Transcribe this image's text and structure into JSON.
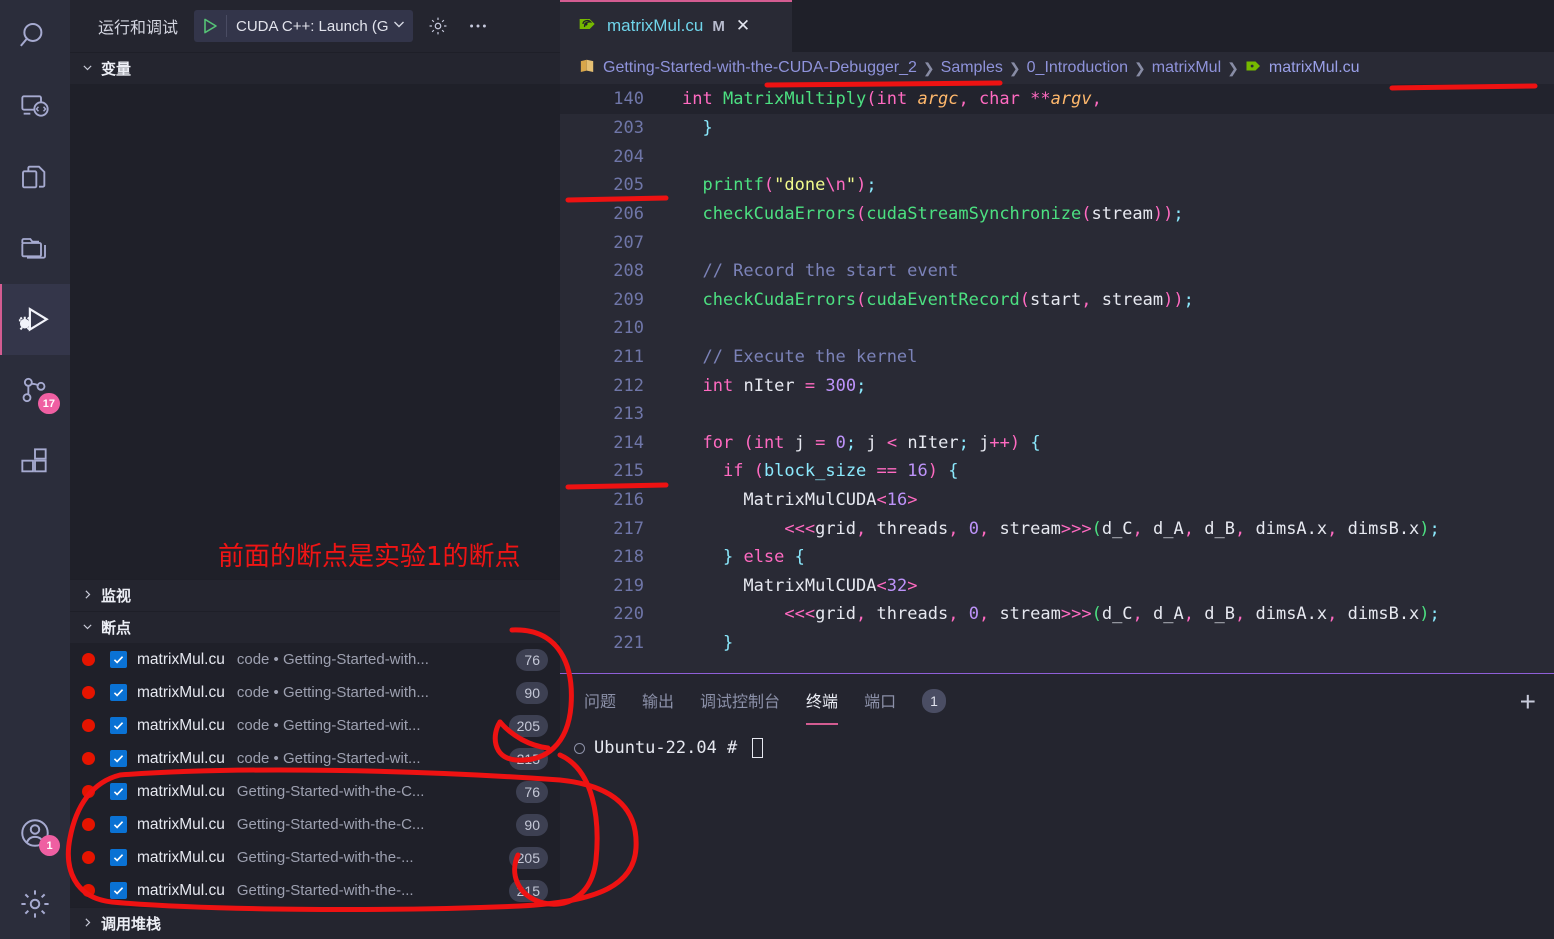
{
  "activity_bar": {
    "items": [
      {
        "name": "search-icon",
        "label": "搜索"
      },
      {
        "name": "remote-explorer-icon",
        "label": "远程资源管理器"
      },
      {
        "name": "copy-files-icon",
        "label": "文件"
      },
      {
        "name": "explorer-folder-icon",
        "label": "资源管理器"
      },
      {
        "name": "run-and-debug-icon",
        "label": "运行和调试"
      },
      {
        "name": "source-control-icon",
        "label": "源代码管理",
        "badge": "17"
      },
      {
        "name": "extensions-icon",
        "label": "扩展"
      }
    ],
    "bottom_items": [
      {
        "name": "accounts-icon",
        "label": "账户",
        "badge": "1"
      },
      {
        "name": "manage-gear-icon",
        "label": "管理"
      }
    ]
  },
  "sidebar": {
    "title": "运行和调试",
    "launch_config": "CUDA C++: Launch (G",
    "gear_tooltip": "打开\"launch.json\"",
    "more_tooltip": "更多操作",
    "sections": [
      {
        "label": "变量",
        "expanded": true
      },
      {
        "label": "监视",
        "expanded": false
      },
      {
        "label": "断点",
        "expanded": true
      },
      {
        "label": "调用堆栈",
        "expanded": false
      }
    ],
    "annotation": "前面的断点是实验1的断点",
    "breakpoints": [
      {
        "file": "matrixMul.cu",
        "path": "code • Getting-Started-with...",
        "line": "76",
        "enabled": true
      },
      {
        "file": "matrixMul.cu",
        "path": "code • Getting-Started-with...",
        "line": "90",
        "enabled": true
      },
      {
        "file": "matrixMul.cu",
        "path": "code • Getting-Started-wit...",
        "line": "205",
        "enabled": true
      },
      {
        "file": "matrixMul.cu",
        "path": "code • Getting-Started-wit...",
        "line": "215",
        "enabled": true
      },
      {
        "file": "matrixMul.cu",
        "path": "Getting-Started-with-the-C...",
        "line": "76",
        "enabled": true
      },
      {
        "file": "matrixMul.cu",
        "path": "Getting-Started-with-the-C...",
        "line": "90",
        "enabled": true
      },
      {
        "file": "matrixMul.cu",
        "path": "Getting-Started-with-the-...",
        "line": "205",
        "enabled": true
      },
      {
        "file": "matrixMul.cu",
        "path": "Getting-Started-with-the-...",
        "line": "215",
        "enabled": true
      }
    ]
  },
  "editor": {
    "tab": {
      "icon": "nvidia-cuda-icon",
      "label": "matrixMul.cu",
      "modified_badge": "M",
      "close": "✕"
    },
    "breadcrumb": [
      "Getting-Started-with-the-CUDA-Debugger_2",
      "Samples",
      "0_Introduction",
      "matrixMul",
      "matrixMul.cu"
    ],
    "sticky_line": {
      "num": "140",
      "text": "int MatrixMultiply(int argc, char **argv,"
    },
    "lines": [
      {
        "num": "203",
        "bp": false
      },
      {
        "num": "204",
        "bp": false
      },
      {
        "num": "205",
        "bp": true
      },
      {
        "num": "206",
        "bp": false
      },
      {
        "num": "207",
        "bp": false
      },
      {
        "num": "208",
        "bp": false
      },
      {
        "num": "209",
        "bp": false
      },
      {
        "num": "210",
        "bp": false
      },
      {
        "num": "211",
        "bp": false
      },
      {
        "num": "212",
        "bp": false
      },
      {
        "num": "213",
        "bp": false
      },
      {
        "num": "214",
        "bp": false
      },
      {
        "num": "215",
        "bp": true
      },
      {
        "num": "216",
        "bp": false
      },
      {
        "num": "217",
        "bp": false
      },
      {
        "num": "218",
        "bp": false
      },
      {
        "num": "219",
        "bp": false
      },
      {
        "num": "220",
        "bp": false
      },
      {
        "num": "221",
        "bp": false
      }
    ],
    "code_text": {
      "l203": "}",
      "l205": "printf(\"done\\n\");",
      "l206": "checkCudaErrors(cudaStreamSynchronize(stream));",
      "l208": "// Record the start event",
      "l209": "checkCudaErrors(cudaEventRecord(start, stream));",
      "l211": "// Execute the kernel",
      "l212": "int nIter = 300;",
      "l214": "for (int j = 0; j < nIter; j++) {",
      "l215": "if (block_size == 16) {",
      "l216": "MatrixMulCUDA<16>",
      "l217": "<<<grid, threads, 0, stream>>>(d_C, d_A, d_B, dimsA.x, dimsB.x);",
      "l218": "} else {",
      "l219": "MatrixMulCUDA<32>",
      "l220": "<<<grid, threads, 0, stream>>>(d_C, d_A, d_B, dimsA.x, dimsB.x);",
      "l221": "}"
    }
  },
  "panel": {
    "tabs": [
      {
        "label": "问题",
        "active": false
      },
      {
        "label": "输出",
        "active": false
      },
      {
        "label": "调试控制台",
        "active": false
      },
      {
        "label": "终端",
        "active": true
      },
      {
        "label": "端口",
        "active": false
      }
    ],
    "ports_badge": "1",
    "add_button": "+",
    "terminal_prompt": "Ubuntu-22.04 #"
  },
  "colors": {
    "accent_pink": "#d35c91",
    "annotation_red": "#f01414",
    "breakpoint_red": "#e51400",
    "checkbox_blue": "#0a72d4",
    "editor_bg": "#292A35",
    "sidebar_bg": "#24252F",
    "activitybar_bg": "#2B2D3B",
    "panel_border": "#8f5fd8",
    "badge_pink": "#ef5fa2"
  }
}
